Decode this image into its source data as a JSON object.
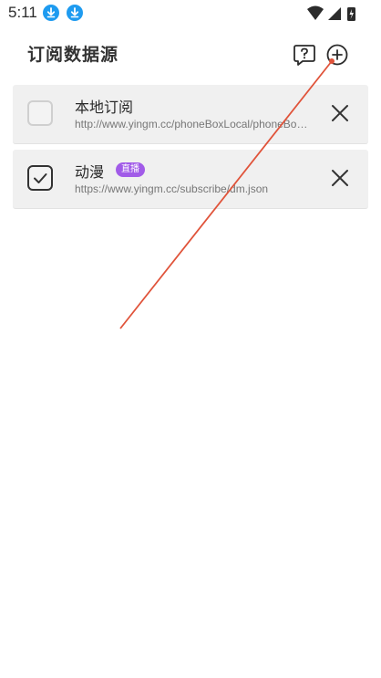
{
  "status_bar": {
    "time": "5:11",
    "icons": [
      "download-icon",
      "download-icon",
      "wifi-icon",
      "signal-icon",
      "battery-icon"
    ],
    "accent_color": "#1e9bf0"
  },
  "header": {
    "title": "订阅数据源",
    "help_icon": "help-chat-icon",
    "add_icon": "add-circle-icon"
  },
  "sources": [
    {
      "name": "本地订阅",
      "url": "http://www.yingm.cc/phoneBoxLocal/phoneBoxLocal.json",
      "checked": false,
      "badge": ""
    },
    {
      "name": "动漫",
      "url": "https://www.yingm.cc/subscribe/dm.json",
      "checked": true,
      "badge": "直播"
    }
  ],
  "colors": {
    "card_bg": "#f0f0f0",
    "badge_bg": "#a15be8",
    "annotation_line": "#e0533a"
  }
}
